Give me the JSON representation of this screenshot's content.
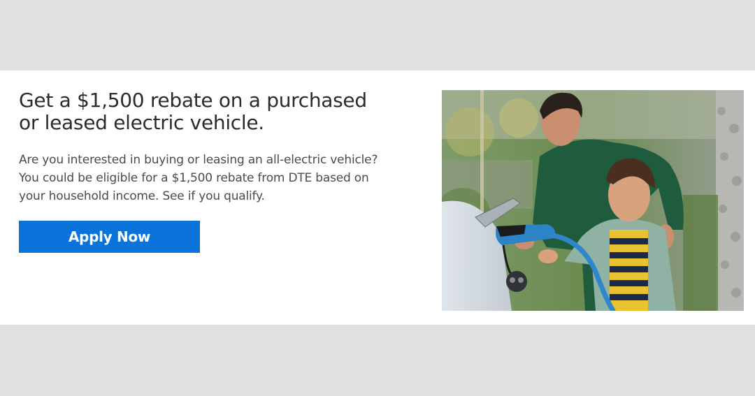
{
  "promo": {
    "headline": "Get a $1,500 rebate on a purchased or leased electric vehicle.",
    "body": "Are you interested in buying or leasing an all-electric vehicle? You could be eligible for a $1,500 rebate from DTE based on your household income. See if you qualify.",
    "cta_label": "Apply Now"
  },
  "colors": {
    "page_background": "#e0e0e0",
    "band_background": "#ffffff",
    "cta_background": "#0a73d9",
    "headline_text": "#2b2b2b",
    "body_text": "#4a4a4a"
  }
}
